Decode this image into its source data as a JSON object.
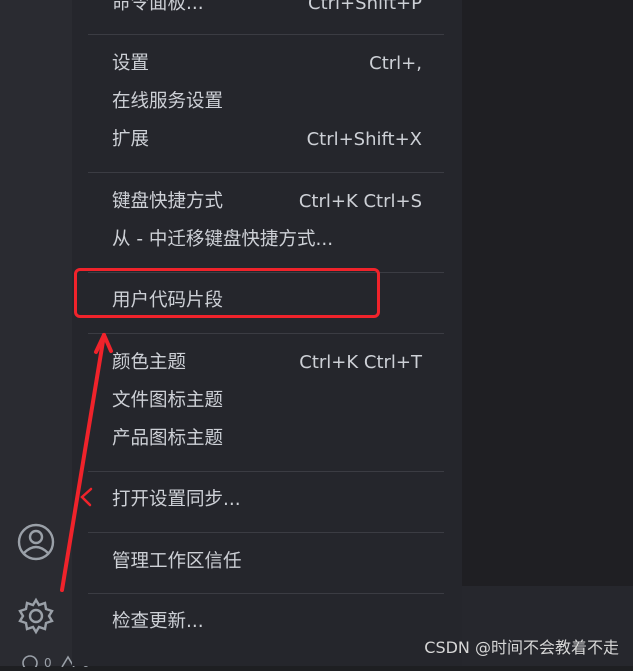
{
  "menu": {
    "items": [
      {
        "label": "命令面板...",
        "shortcut": "Ctrl+Shift+P"
      },
      {
        "label": "设置",
        "shortcut": "Ctrl+,"
      },
      {
        "label": "在线服务设置",
        "shortcut": ""
      },
      {
        "label": "扩展",
        "shortcut": "Ctrl+Shift+X"
      },
      {
        "label": "键盘快捷方式",
        "shortcut": "Ctrl+K Ctrl+S"
      },
      {
        "label": "从 - 中迁移键盘快捷方式...",
        "shortcut": ""
      },
      {
        "label": "用户代码片段",
        "shortcut": ""
      },
      {
        "label": "颜色主题",
        "shortcut": "Ctrl+K Ctrl+T"
      },
      {
        "label": "文件图标主题",
        "shortcut": ""
      },
      {
        "label": "产品图标主题",
        "shortcut": ""
      },
      {
        "label": "打开设置同步...",
        "shortcut": ""
      },
      {
        "label": "管理工作区信任",
        "shortcut": ""
      },
      {
        "label": "检查更新...",
        "shortcut": ""
      }
    ]
  },
  "activity_bar": {
    "icons": [
      "account-icon",
      "gear-icon"
    ]
  },
  "annotation": {
    "color": "#f0232b"
  },
  "watermark": "CSDN @时间不会教着不走"
}
